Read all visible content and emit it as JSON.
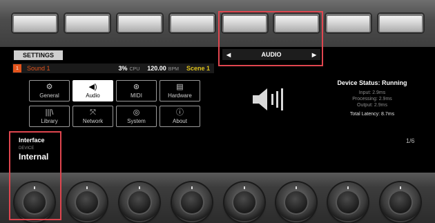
{
  "settings_tab": "SETTINGS",
  "selector": {
    "left_arrow": "◀",
    "label": "AUDIO",
    "right_arrow": "▶"
  },
  "status_bar": {
    "group_number": "1",
    "sound": "Sound 1",
    "cpu_value": "3%",
    "cpu_label": "CPU",
    "bpm_value": "120.00",
    "bpm_label": "BPM",
    "scene": "Scene 1"
  },
  "categories": [
    {
      "label": "General",
      "icon": "gear-icon",
      "glyph": "⚙",
      "active": false
    },
    {
      "label": "Audio",
      "icon": "speaker-icon",
      "glyph": "◀)",
      "active": true
    },
    {
      "label": "MIDI",
      "icon": "midi-icon",
      "glyph": "⊛",
      "active": false
    },
    {
      "label": "Hardware",
      "icon": "hardware-icon",
      "glyph": "▤",
      "active": false
    },
    {
      "label": "Library",
      "icon": "library-icon",
      "glyph": "|||\\",
      "active": false
    },
    {
      "label": "Network",
      "icon": "network-icon",
      "glyph": "⤧",
      "active": false
    },
    {
      "label": "System",
      "icon": "system-icon",
      "glyph": "◎",
      "active": false
    },
    {
      "label": "About",
      "icon": "info-icon",
      "glyph": "ⓘ",
      "active": false
    }
  ],
  "device_status": {
    "title": "Device Status: Running",
    "input": "Input: 2.9ms",
    "processing": "Processing: 2.9ms",
    "output": "Output: 2.9ms",
    "total": "Total Latency: 8.7ms"
  },
  "page_indicator": "1/6",
  "interface": {
    "title": "Interface",
    "label": "DEVICE",
    "value": "Internal"
  },
  "colors": {
    "accent_orange": "#e4541c",
    "scene_yellow": "#e0c31a",
    "highlight_red": "#e0464f"
  }
}
